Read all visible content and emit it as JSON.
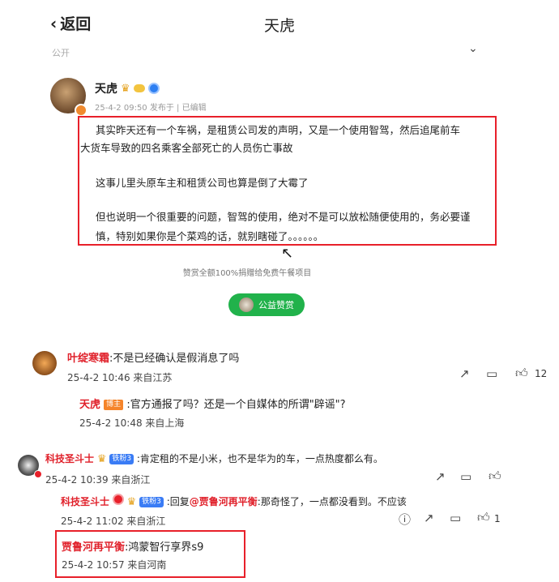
{
  "header": {
    "back_label": "返回",
    "title": "天虎"
  },
  "visibility": "公开",
  "post": {
    "author": "天虎",
    "meta": "25-4-2 09:50 发布于 | 已编辑",
    "paragraphs": [
      "其实昨天还有一个车祸，是租赁公司发的声明，又是一个使用智驾，然后追尾前车",
      "大货车导致的四名乘客全部死亡的人员伤亡事故",
      "这事儿里头原车主和租赁公司也算是倒了大霉了",
      "但也说明一个很重要的问题，智驾的使用，绝对不是可以放松随便使用的，务必要谨",
      "慎，特别如果你是个菜鸡的话，就别瞎碰了。。。。。。"
    ],
    "reward_note": "赞赏全额100%捐赠给免费午餐项目",
    "reward_button": "公益赞赏"
  },
  "comments": [
    {
      "user": "叶绽寒霜",
      "text": ":不是已经确认是假消息了吗",
      "time": "25-4-2 10:46 来自江苏",
      "likes": "12"
    },
    {
      "user": "天虎",
      "tag": "博主",
      "text": ":官方通报了吗？还是一个自媒体的所谓\"辟谣\"?",
      "time": "25-4-2 10:48 来自上海"
    },
    {
      "user": "科技圣斗士",
      "tag": "铁粉3",
      "text": ":肯定租的不是小米，也不是华为的车，一点热度都么有。",
      "time": "25-4-2 10:39 来自浙江"
    },
    {
      "user": "科技圣斗士",
      "tag": "铁粉3",
      "text_prefix": ":回复",
      "mention": "@贾鲁河再平衡",
      "text": ":那奇怪了，一点都没看到。不应该",
      "time": "25-4-2 11:02 来自浙江",
      "likes": "1"
    },
    {
      "user": "贾鲁河再平衡",
      "text": ":鸿蒙智行享界s9",
      "time": "25-4-2 10:57 来自河南"
    }
  ],
  "icons": [
    "back-icon",
    "chevron-down-icon",
    "share-icon",
    "comment-icon",
    "like-icon",
    "report-icon"
  ],
  "colors": {
    "highlight": "#e8202a",
    "username": "#e0202a",
    "reward": "#21b24b",
    "verify": "#2d7ff2"
  }
}
